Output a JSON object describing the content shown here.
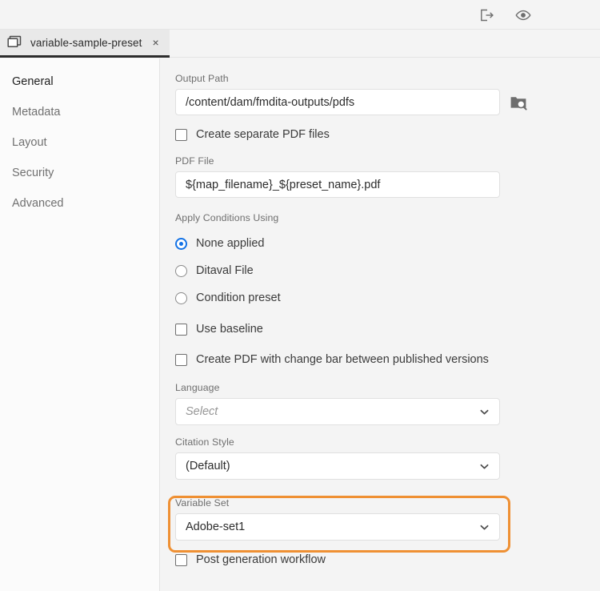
{
  "header": {
    "icons": [
      {
        "name": "export-icon",
        "title": "Export"
      },
      {
        "name": "preview-eye-icon",
        "title": "Preview"
      }
    ]
  },
  "tab": {
    "icon": "windows-stack-icon",
    "label": "variable-sample-preset",
    "close_label": "×"
  },
  "sidebar": {
    "items": [
      {
        "label": "General",
        "active": true
      },
      {
        "label": "Metadata",
        "active": false
      },
      {
        "label": "Layout",
        "active": false
      },
      {
        "label": "Security",
        "active": false
      },
      {
        "label": "Advanced",
        "active": false
      }
    ]
  },
  "form": {
    "output_path": {
      "label": "Output Path",
      "value": "/content/dam/fmdita-outputs/pdfs",
      "browse_icon": "folder-search-icon"
    },
    "create_separate_pdf": {
      "label": "Create separate PDF files",
      "checked": false
    },
    "pdf_file": {
      "label": "PDF File",
      "value": "${map_filename}_${preset_name}.pdf"
    },
    "apply_conditions": {
      "label": "Apply Conditions Using",
      "options": [
        {
          "label": "None applied",
          "selected": true
        },
        {
          "label": "Ditaval File",
          "selected": false
        },
        {
          "label": "Condition preset",
          "selected": false
        }
      ]
    },
    "use_baseline": {
      "label": "Use baseline",
      "checked": false
    },
    "change_bar": {
      "label": "Create PDF with change bar between published versions",
      "checked": false
    },
    "language": {
      "label": "Language",
      "value": "",
      "placeholder": "Select",
      "chevron": "chevron-down-icon"
    },
    "citation_style": {
      "label": "Citation Style",
      "value": "(Default)",
      "chevron": "chevron-down-icon"
    },
    "variable_set": {
      "label": "Variable Set",
      "value": "Adobe-set1",
      "chevron": "chevron-down-icon",
      "highlighted": true
    },
    "post_generation_workflow": {
      "label": "Post generation workflow",
      "checked": false
    }
  },
  "colors": {
    "accent_blue": "#1473E6",
    "highlight_orange": "#EF9033",
    "panel_bg": "#F4F4F4",
    "sidebar_bg": "#FBFBFB",
    "tab_bg": "#E9E9E9",
    "text_primary": "#2C2C2C",
    "text_muted": "#6E6E6E"
  }
}
